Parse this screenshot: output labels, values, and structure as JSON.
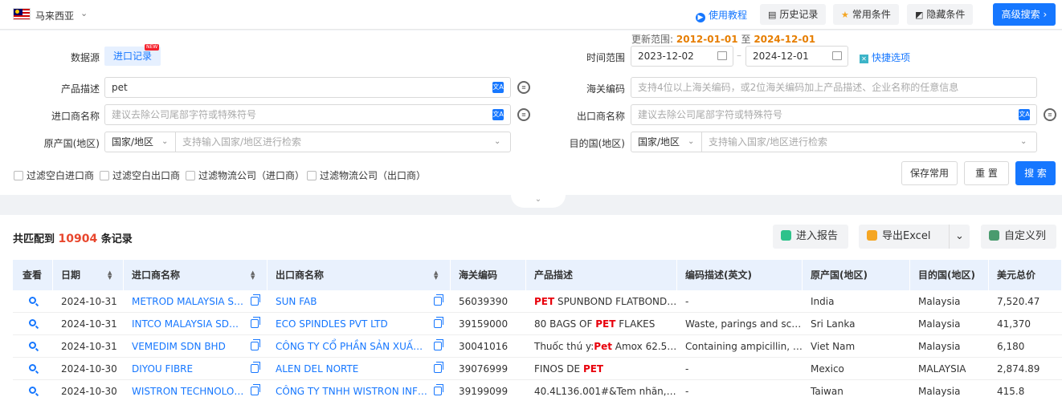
{
  "topbar": {
    "country": "马来西亚",
    "tutorial": "使用教程",
    "history": "历史记录",
    "favorites": "常用条件",
    "hide_conditions": "隐藏条件",
    "advanced_search": "高级搜索"
  },
  "form": {
    "update_range_label": "更新范围:",
    "update_start": "2012-01-01",
    "update_to": "至",
    "update_end": "2024-12-01",
    "datasource_label": "数据源",
    "datasource_value": "进口记录",
    "new_badge": "NEW",
    "time_range_label": "时间范围",
    "date_start": "2023-12-02",
    "date_sep": "–",
    "date_end": "2024-12-01",
    "quick_options": "快捷选项",
    "product_desc_label": "产品描述",
    "product_desc_value": "pet",
    "hs_code_label": "海关编码",
    "hs_code_placeholder": "支持4位以上海关编码，或2位海关编码加上产品描述、企业名称的任意信息",
    "importer_label": "进口商名称",
    "importer_placeholder": "建议去除公司尾部字符或特殊符号",
    "exporter_label": "出口商名称",
    "exporter_placeholder": "建议去除公司尾部字符或特殊符号",
    "origin_label": "原产国(地区)",
    "origin_select": "国家/地区",
    "origin_placeholder": "支持输入国家/地区进行检索",
    "dest_label": "目的国(地区)",
    "dest_select": "国家/地区",
    "dest_placeholder": "支持输入国家/地区进行检索",
    "filters": [
      "过滤空白进口商",
      "过滤空白出口商",
      "过滤物流公司（进口商）",
      "过滤物流公司（出口商）"
    ],
    "save_button": "保存常用",
    "reset_button": "重 置",
    "search_button": "搜 索"
  },
  "results": {
    "prefix": "共匹配到",
    "count": "10904",
    "suffix": "条记录",
    "report_button": "进入报告",
    "export_button": "导出Excel",
    "custom_columns_button": "自定义列"
  },
  "table": {
    "columns": [
      "查看",
      "日期",
      "进口商名称",
      "出口商名称",
      "海关编码",
      "产品描述",
      "编码描述(英文)",
      "原产国(地区)",
      "目的国(地区)",
      "美元总价"
    ],
    "rows": [
      {
        "date": "2024-10-31",
        "importer": "METROD MALAYSIA SD...",
        "exporter": "SUN FAB",
        "hs": "56039390",
        "desc_pre": "",
        "desc_kw": "PET",
        "desc_post": " SPUNBOND FLATBOND F...",
        "hs_desc": "-",
        "origin": "India",
        "dest": "Malaysia",
        "value": "7,520.47"
      },
      {
        "date": "2024-10-31",
        "importer": "INTCO MALAYSIA SDN BH",
        "exporter": "ECO SPINDLES PVT LTD",
        "hs": "39159000",
        "desc_pre": "80 BAGS OF ",
        "desc_kw": "PET",
        "desc_post": " FLAKES",
        "hs_desc": "Waste, parings and scra...",
        "origin": "Sri Lanka",
        "dest": "Malaysia",
        "value": "41,370"
      },
      {
        "date": "2024-10-31",
        "importer": "VEMEDIM SDN BHD",
        "exporter": "CÔNG TY CỔ PHẦN SẢN XUẤT KI...",
        "hs": "30041016",
        "desc_pre": "Thuốc thú y:",
        "desc_kw": "Pet",
        "desc_post": " Amox 62.5 m...",
        "hs_desc": "Containing ampicillin, a...",
        "origin": "Viet Nam",
        "dest": "Malaysia",
        "value": "6,180"
      },
      {
        "date": "2024-10-30",
        "importer": "DIYOU FIBRE",
        "exporter": "ALEN DEL NORTE",
        "hs": "39076999",
        "desc_pre": "FINOS DE ",
        "desc_kw": "PET",
        "desc_post": "",
        "hs_desc": "-",
        "origin": "Mexico",
        "dest": "MALAYSIA",
        "value": "2,874.89"
      },
      {
        "date": "2024-10-30",
        "importer": "WISTRON TECHNOLOG...",
        "exporter": "CÔNG TY TNHH WISTRON INFO...",
        "hs": "39199099",
        "desc_pre": "40.4L136.001#&Tem nhãn,chấ...",
        "desc_kw": "",
        "desc_post": "",
        "hs_desc": "-",
        "origin": "Taiwan",
        "dest": "Malaysia",
        "value": "415.8"
      }
    ]
  },
  "colors": {
    "primary": "#1677ff",
    "highlight": "#e8000b",
    "count": "#e8472e",
    "update_date": "#e67e00"
  }
}
